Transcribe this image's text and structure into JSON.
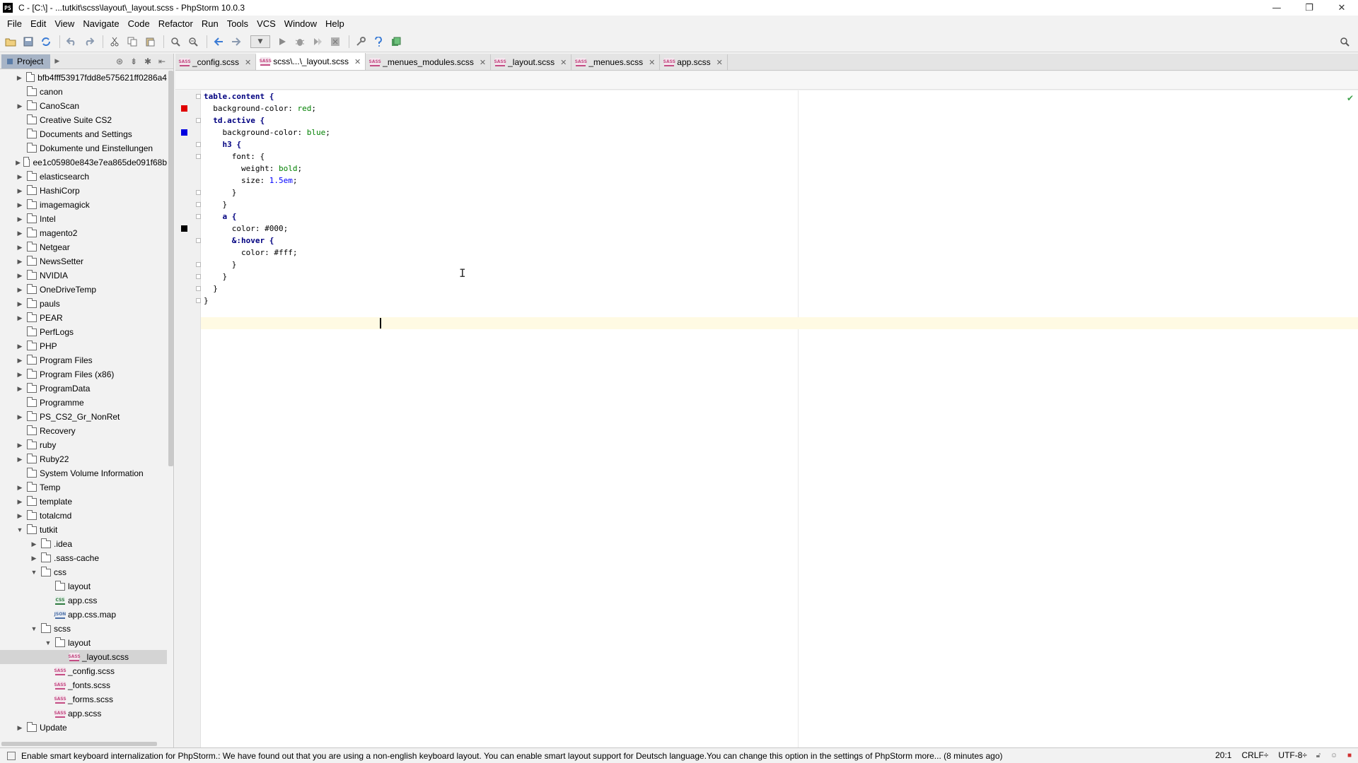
{
  "window": {
    "logo": "PS",
    "title": "C - [C:\\] - ...tutkit\\scss\\layout\\_layout.scss - PhpStorm 10.0.3",
    "controls": [
      "—",
      "❐",
      "✕"
    ]
  },
  "menu": [
    "File",
    "Edit",
    "View",
    "Navigate",
    "Code",
    "Refactor",
    "Run",
    "Tools",
    "VCS",
    "Window",
    "Help"
  ],
  "project_panel": {
    "tab_label": "Project",
    "tree": [
      {
        "label": "bfb4fff53917fdd8e575621ff0286a4",
        "type": "folder",
        "level": 0,
        "arrow": "right"
      },
      {
        "label": "canon",
        "type": "folder",
        "level": 0,
        "arrow": ""
      },
      {
        "label": "CanoScan",
        "type": "folder",
        "level": 0,
        "arrow": "right"
      },
      {
        "label": "Creative Suite CS2",
        "type": "folder",
        "level": 0,
        "arrow": ""
      },
      {
        "label": "Documents and Settings",
        "type": "folder",
        "level": 0,
        "arrow": ""
      },
      {
        "label": "Dokumente und Einstellungen",
        "type": "folder",
        "level": 0,
        "arrow": ""
      },
      {
        "label": "ee1c05980e843e7ea865de091f68b",
        "type": "folder",
        "level": 0,
        "arrow": "right"
      },
      {
        "label": "elasticsearch",
        "type": "folder",
        "level": 0,
        "arrow": "right"
      },
      {
        "label": "HashiCorp",
        "type": "folder",
        "level": 0,
        "arrow": "right"
      },
      {
        "label": "imagemagick",
        "type": "folder",
        "level": 0,
        "arrow": "right"
      },
      {
        "label": "Intel",
        "type": "folder",
        "level": 0,
        "arrow": "right"
      },
      {
        "label": "magento2",
        "type": "folder",
        "level": 0,
        "arrow": "right"
      },
      {
        "label": "Netgear",
        "type": "folder",
        "level": 0,
        "arrow": "right"
      },
      {
        "label": "NewsSetter",
        "type": "folder",
        "level": 0,
        "arrow": "right"
      },
      {
        "label": "NVIDIA",
        "type": "folder",
        "level": 0,
        "arrow": "right"
      },
      {
        "label": "OneDriveTemp",
        "type": "folder",
        "level": 0,
        "arrow": "right"
      },
      {
        "label": "pauls",
        "type": "folder",
        "level": 0,
        "arrow": "right"
      },
      {
        "label": "PEAR",
        "type": "folder",
        "level": 0,
        "arrow": "right"
      },
      {
        "label": "PerfLogs",
        "type": "folder",
        "level": 0,
        "arrow": ""
      },
      {
        "label": "PHP",
        "type": "folder",
        "level": 0,
        "arrow": "right"
      },
      {
        "label": "Program Files",
        "type": "folder",
        "level": 0,
        "arrow": "right"
      },
      {
        "label": "Program Files (x86)",
        "type": "folder",
        "level": 0,
        "arrow": "right"
      },
      {
        "label": "ProgramData",
        "type": "folder",
        "level": 0,
        "arrow": "right"
      },
      {
        "label": "Programme",
        "type": "folder",
        "level": 0,
        "arrow": ""
      },
      {
        "label": "PS_CS2_Gr_NonRet",
        "type": "folder",
        "level": 0,
        "arrow": "right"
      },
      {
        "label": "Recovery",
        "type": "folder",
        "level": 0,
        "arrow": ""
      },
      {
        "label": "ruby",
        "type": "folder",
        "level": 0,
        "arrow": "right"
      },
      {
        "label": "Ruby22",
        "type": "folder",
        "level": 0,
        "arrow": "right"
      },
      {
        "label": "System Volume Information",
        "type": "folder",
        "level": 0,
        "arrow": ""
      },
      {
        "label": "Temp",
        "type": "folder",
        "level": 0,
        "arrow": "right"
      },
      {
        "label": "template",
        "type": "folder",
        "level": 0,
        "arrow": "right"
      },
      {
        "label": "totalcmd",
        "type": "folder",
        "level": 0,
        "arrow": "right"
      },
      {
        "label": "tutkit",
        "type": "folder",
        "level": 0,
        "arrow": "down"
      },
      {
        "label": ".idea",
        "type": "folder",
        "level": 1,
        "arrow": "right"
      },
      {
        "label": ".sass-cache",
        "type": "folder",
        "level": 1,
        "arrow": "right"
      },
      {
        "label": "css",
        "type": "folder",
        "level": 1,
        "arrow": "down"
      },
      {
        "label": "layout",
        "type": "folder",
        "level": 2,
        "arrow": ""
      },
      {
        "label": "app.css",
        "type": "css",
        "level": 2,
        "arrow": ""
      },
      {
        "label": "app.css.map",
        "type": "json",
        "level": 2,
        "arrow": ""
      },
      {
        "label": "scss",
        "type": "folder",
        "level": 1,
        "arrow": "down"
      },
      {
        "label": "layout",
        "type": "folder",
        "level": 2,
        "arrow": "down"
      },
      {
        "label": "_layout.scss",
        "type": "sass",
        "level": 3,
        "arrow": "",
        "selected": true
      },
      {
        "label": "_config.scss",
        "type": "sass",
        "level": 2,
        "arrow": ""
      },
      {
        "label": "_fonts.scss",
        "type": "sass",
        "level": 2,
        "arrow": ""
      },
      {
        "label": "_forms.scss",
        "type": "sass",
        "level": 2,
        "arrow": ""
      },
      {
        "label": "app.scss",
        "type": "sass",
        "level": 2,
        "arrow": ""
      },
      {
        "label": "Update",
        "type": "folder",
        "level": 0,
        "arrow": "right"
      }
    ]
  },
  "file_icon_text": "SASS",
  "css_icon_text": "CSS",
  "json_icon_text": "JSON",
  "editor_tabs": [
    {
      "label": "_config.scss",
      "active": false
    },
    {
      "label": "scss\\...\\_layout.scss",
      "active": true
    },
    {
      "label": "_menues_modules.scss",
      "active": false
    },
    {
      "label": "_layout.scss",
      "active": false
    },
    {
      "label": "_menues.scss",
      "active": false
    },
    {
      "label": "app.scss",
      "active": false
    }
  ],
  "editor": {
    "lines": [
      [
        [
          "table.content {",
          "kw"
        ]
      ],
      [
        [
          "  background-color: ",
          "prop"
        ],
        [
          "red",
          "val"
        ],
        [
          ";",
          "prop"
        ]
      ],
      [
        [
          "  td.active {",
          "kw"
        ]
      ],
      [
        [
          "    background-color: ",
          "prop"
        ],
        [
          "blue",
          "val"
        ],
        [
          ";",
          "prop"
        ]
      ],
      [
        [
          "    h3 {",
          "kw"
        ]
      ],
      [
        [
          "      font: {",
          "prop"
        ]
      ],
      [
        [
          "        weight: ",
          "prop"
        ],
        [
          "bold",
          "val"
        ],
        [
          ";",
          "prop"
        ]
      ],
      [
        [
          "        size: ",
          "prop"
        ],
        [
          "1.5em",
          "num"
        ],
        [
          ";",
          "prop"
        ]
      ],
      [
        [
          "      }",
          "brace"
        ]
      ],
      [
        [
          "    }",
          "brace"
        ]
      ],
      [
        [
          "    a {",
          "kw"
        ]
      ],
      [
        [
          "      color: ",
          "prop"
        ],
        [
          "#000",
          "hash"
        ],
        [
          ";",
          "prop"
        ]
      ],
      [
        [
          "      &:hover {",
          "kw"
        ]
      ],
      [
        [
          "        color: ",
          "prop"
        ],
        [
          "#fff",
          "hash"
        ],
        [
          ";",
          "prop"
        ]
      ],
      [
        [
          "      }",
          "brace"
        ]
      ],
      [
        [
          "    }",
          "brace"
        ]
      ],
      [
        [
          "  }",
          "brace"
        ]
      ],
      [
        [
          "}",
          "brace"
        ]
      ],
      [
        [
          "",
          "prop"
        ]
      ],
      [
        [
          "",
          "prop"
        ]
      ]
    ],
    "gutter_marks": [
      {
        "line": 2,
        "color": "#e00000"
      },
      {
        "line": 4,
        "color": "#0000e0"
      },
      {
        "line": 12,
        "color": "#000000"
      }
    ]
  },
  "status": {
    "message": "Enable smart keyboard internalization for PhpStorm.: We have found out that you are using a non-english keyboard layout. You can enable smart layout support for Deutsch language.You can change this option in the settings of PhpStorm more... (8 minutes ago)",
    "position": "20:1",
    "line_sep": "CRLF÷",
    "encoding": "UTF-8÷"
  }
}
